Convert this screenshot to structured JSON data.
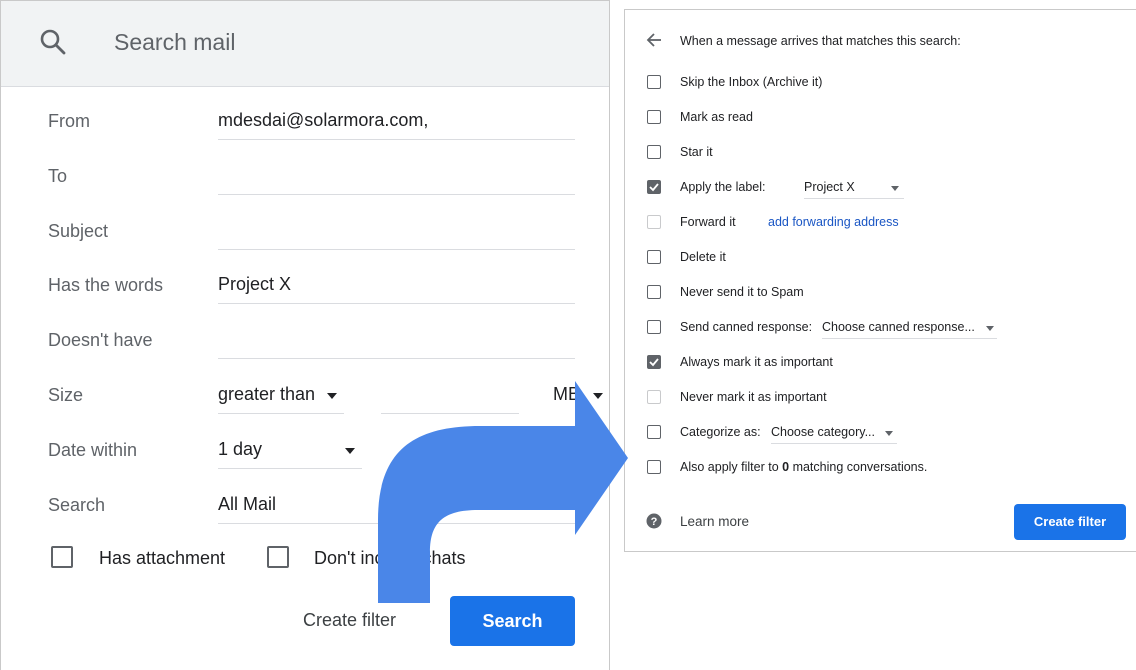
{
  "left": {
    "search_placeholder": "Search mail",
    "fields": {
      "from": {
        "label": "From",
        "value": "mdesdai@solarmora.com,"
      },
      "to": {
        "label": "To",
        "value": ""
      },
      "subject": {
        "label": "Subject",
        "value": ""
      },
      "has_words": {
        "label": "Has the words",
        "value": "Project X"
      },
      "doesnt_have": {
        "label": "Doesn't have",
        "value": ""
      },
      "size": {
        "label": "Size",
        "operator": "greater than",
        "amount": "",
        "unit": "MB"
      },
      "date_within": {
        "label": "Date within",
        "value": "1 day"
      },
      "search": {
        "label": "Search",
        "value": "All Mail"
      }
    },
    "has_attachment": {
      "label": "Has attachment",
      "checked": false
    },
    "dont_include_chats": {
      "label": "Don't include chats",
      "checked": false
    },
    "create_filter_label": "Create filter",
    "search_button_label": "Search"
  },
  "right": {
    "header": "When a message arrives that matches this search:",
    "options": {
      "skip_inbox": {
        "label": "Skip the Inbox (Archive it)",
        "checked": false
      },
      "mark_read": {
        "label": "Mark as read",
        "checked": false
      },
      "star": {
        "label": "Star it",
        "checked": false
      },
      "apply_label": {
        "label": "Apply the label:",
        "checked": true,
        "select_value": "Project X"
      },
      "forward": {
        "label": "Forward it",
        "checked": false,
        "disabled": true,
        "link": "add forwarding address"
      },
      "delete": {
        "label": "Delete it",
        "checked": false
      },
      "never_spam": {
        "label": "Never send it to Spam",
        "checked": false
      },
      "canned": {
        "label": "Send canned response:",
        "checked": false,
        "select_value": "Choose canned response..."
      },
      "always_important": {
        "label": "Always mark it as important",
        "checked": true
      },
      "never_important": {
        "label": "Never mark it as important",
        "checked": false,
        "disabled": true
      },
      "categorize": {
        "label": "Categorize as:",
        "checked": false,
        "select_value": "Choose category..."
      },
      "also_apply": {
        "label_prefix": "Also apply filter to ",
        "count": "0",
        "label_suffix": " matching conversations.",
        "checked": false
      }
    },
    "learn_more": "Learn more",
    "create_filter_button": "Create filter"
  },
  "colors": {
    "accent": "#1a73e8",
    "arrow": "#4a86e8",
    "checkbox_checked": "#5f6368"
  }
}
